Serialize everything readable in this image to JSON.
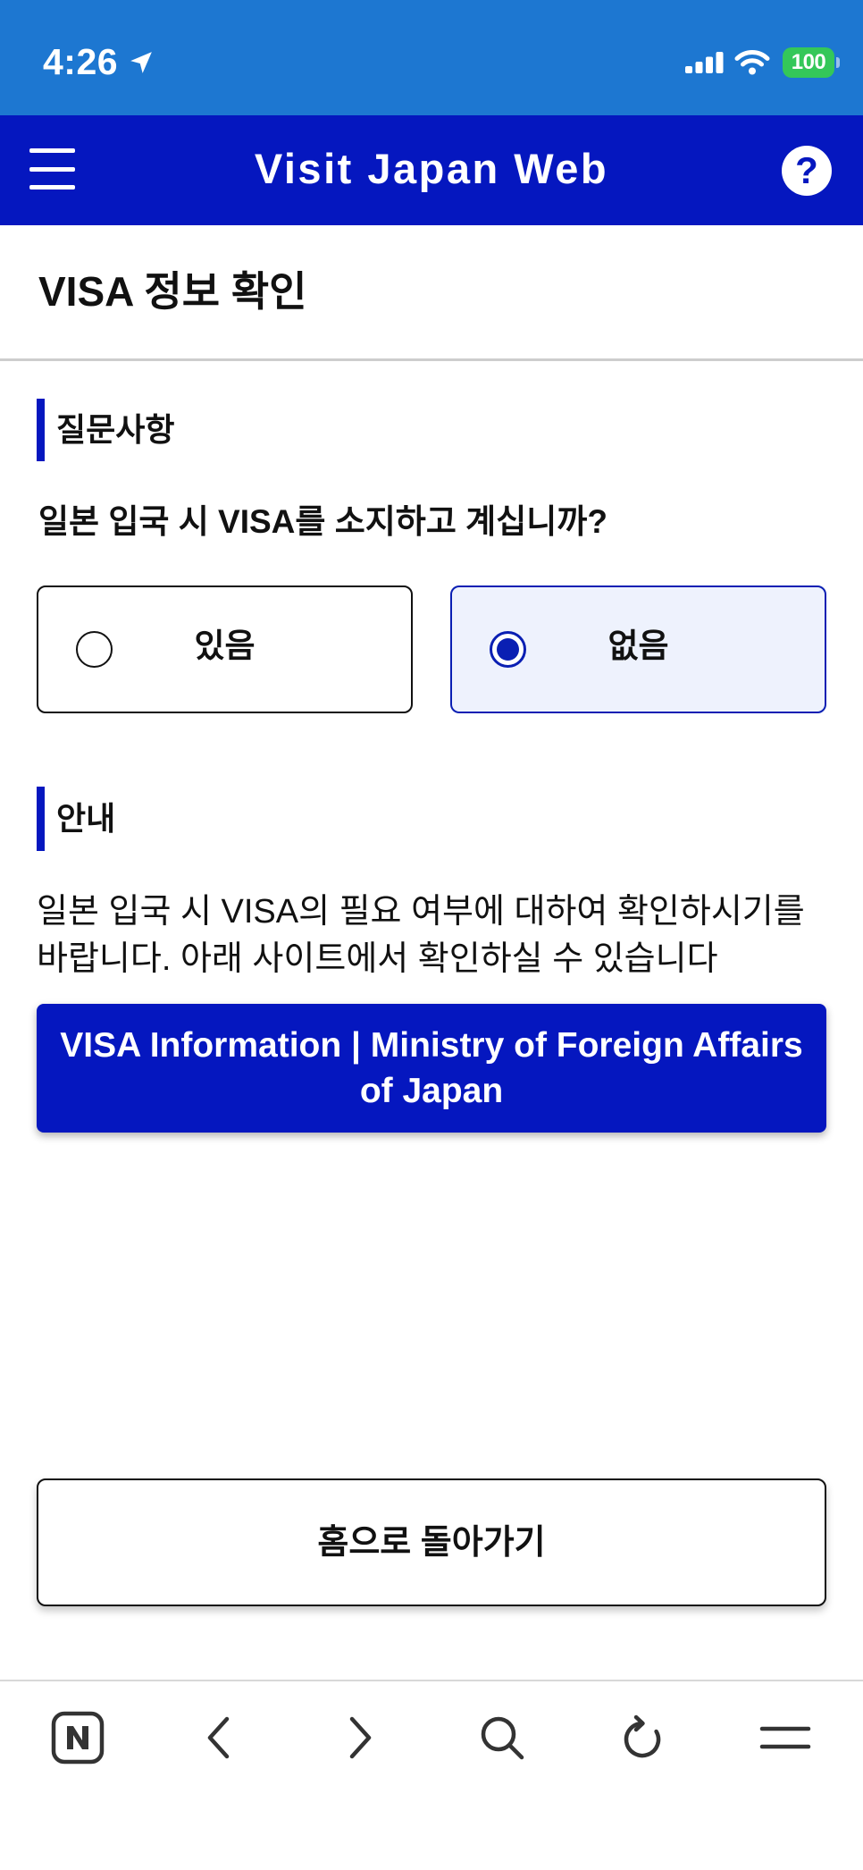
{
  "status_bar": {
    "time": "4:26",
    "battery_level": "100",
    "icons": [
      "location-arrow-icon",
      "cellular-signal-icon",
      "wifi-icon",
      "battery-icon"
    ]
  },
  "header": {
    "title": "Visit Japan Web",
    "help_glyph": "?",
    "icons": {
      "menu": "hamburger-menu-icon",
      "help": "help-icon"
    }
  },
  "page": {
    "title": "VISA 정보 확인"
  },
  "question_section": {
    "heading": "질문사항",
    "question": "일본 입국 시 VISA를 소지하고 계십니까?",
    "options": [
      {
        "label": "있음",
        "selected": false
      },
      {
        "label": "없음",
        "selected": true
      }
    ]
  },
  "info_section": {
    "heading": "안내",
    "text": "일본 입국 시 VISA의 필요 여부에 대하여 확인하시기를 바랍니다. 아래 사이트에서 확인하실 수 있습니다",
    "link_button_label": "VISA Information | Ministry of Foreign Affairs of Japan"
  },
  "home_button_label": "홈으로 돌아가기",
  "browser_toolbar": {
    "icons": [
      "naver-n-icon",
      "chevron-left-icon",
      "chevron-right-icon",
      "search-icon",
      "reload-icon",
      "menu-icon"
    ]
  },
  "colors": {
    "status_bar": "#1d77d1",
    "header": "#0517bf",
    "accent": "#0517bf",
    "selected_border": "#0a1fb3",
    "selected_option_bg": "#eef2fd",
    "battery": "#34c759"
  }
}
